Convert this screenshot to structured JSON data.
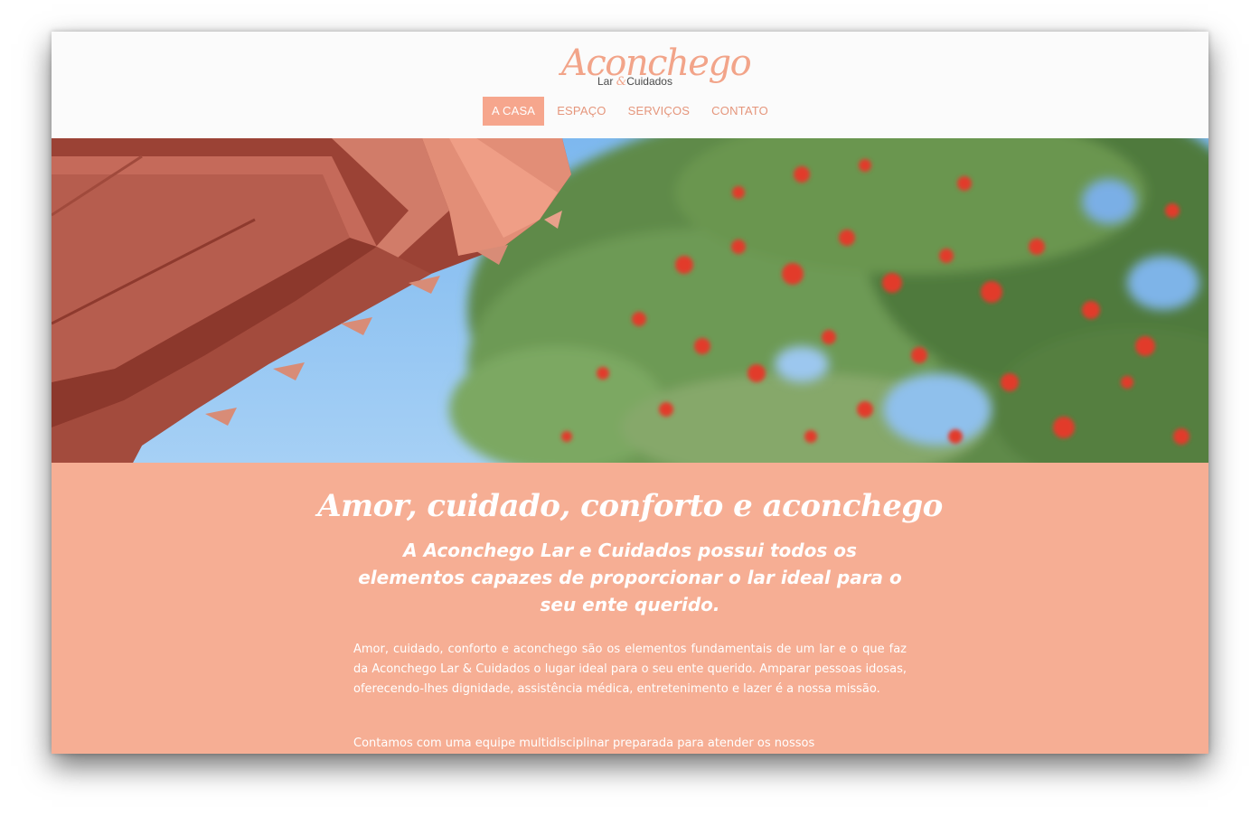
{
  "site": {
    "logo": {
      "name": "Aconchego",
      "sub_left": "Lar",
      "sub_amp": "&",
      "sub_right": "Cuidados"
    },
    "nav": [
      {
        "label": "A CASA",
        "active": true
      },
      {
        "label": "ESPAÇO",
        "active": false
      },
      {
        "label": "SERVIÇOS",
        "active": false
      },
      {
        "label": "CONTATO",
        "active": false
      }
    ],
    "colors": {
      "accent": "#f6a68d",
      "content_bg": "#f6ae94",
      "nav_text": "#e5967c",
      "sky": "#83bcf0",
      "roof": "#b85a4b"
    }
  },
  "main": {
    "title": "Amor, cuidado, conforto e aconchego",
    "subtitle": "A Aconchego Lar e Cuidados possui todos os elementos capazes de proporcionar o lar ideal para o seu ente querido.",
    "paragraphs": [
      "Amor, cuidado, conforto e aconchego são os elementos fundamentais de um lar e o que faz da Aconchego Lar & Cuidados o lugar ideal para o seu ente querido. Amparar pessoas idosas, oferecendo-lhes dignidade, assistência médica, entretenimento e lazer é a nossa missão.",
      "Contamos com uma equipe multidisciplinar preparada para atender os nossos"
    ]
  }
}
